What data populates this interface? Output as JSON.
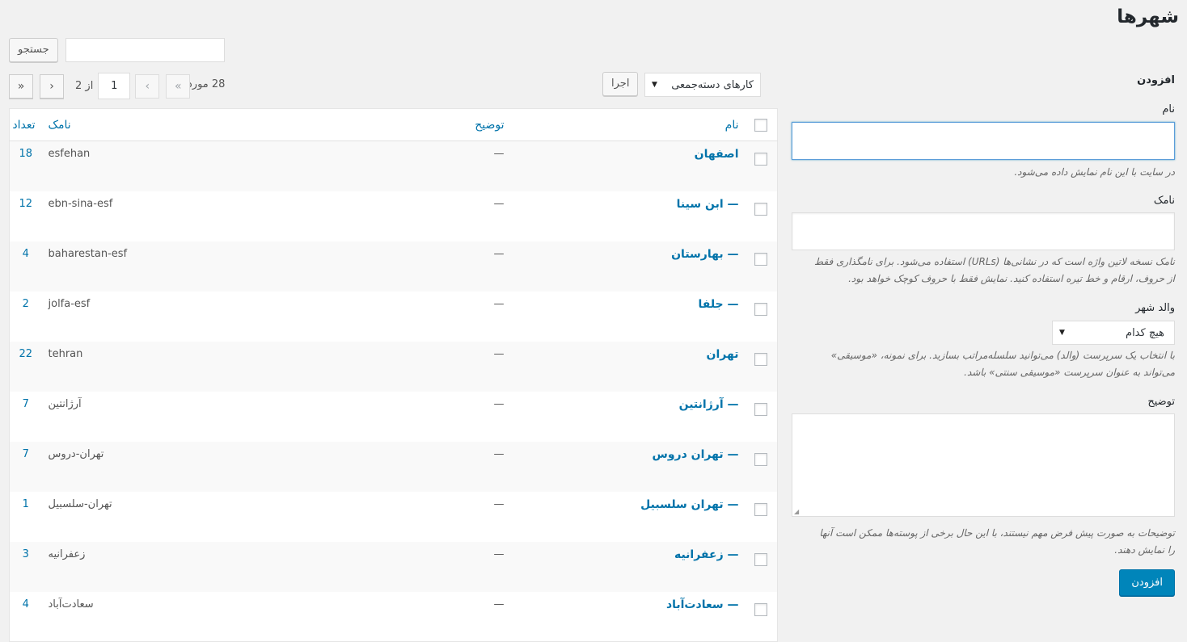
{
  "page": {
    "title": "شهرها"
  },
  "search": {
    "button_label": "جستجو",
    "value": ""
  },
  "bulk": {
    "selected": "کارهای دسته‌جمعی",
    "apply_label": "اجرا"
  },
  "pagination": {
    "items_text": "28 مورد",
    "current_page": "1",
    "of_text": "از 2",
    "first": "«",
    "prev": "‹",
    "next": "›",
    "last": "»"
  },
  "table": {
    "headers": {
      "name": "نام",
      "description": "توضیح",
      "slug": "نامک",
      "count": "تعداد"
    },
    "rows": [
      {
        "name": "اصفهان",
        "description": "—",
        "slug": "esfehan",
        "count": "18"
      },
      {
        "name": "— ابن سینا",
        "description": "—",
        "slug": "ebn-sina-esf",
        "count": "12"
      },
      {
        "name": "— بهارستان",
        "description": "—",
        "slug": "baharestan-esf",
        "count": "4"
      },
      {
        "name": "— جلفا",
        "description": "—",
        "slug": "jolfa-esf",
        "count": "2"
      },
      {
        "name": "تهران",
        "description": "—",
        "slug": "tehran",
        "count": "22"
      },
      {
        "name": "— آرژانتین",
        "description": "—",
        "slug": "آرژانتین",
        "count": "7"
      },
      {
        "name": "— تهران دروس",
        "description": "—",
        "slug": "تهران-دروس",
        "count": "7"
      },
      {
        "name": "— تهران سلسبیل",
        "description": "—",
        "slug": "تهران-سلسبیل",
        "count": "1"
      },
      {
        "name": "— زعفرانیه",
        "description": "—",
        "slug": "زعفرانیه",
        "count": "3"
      },
      {
        "name": "— سعادت‌آباد",
        "description": "—",
        "slug": "سعادت‌آباد",
        "count": "4"
      }
    ]
  },
  "form": {
    "heading": "افزودن",
    "name_label": "نام",
    "name_value": "",
    "name_hint": "در سایت با این نام نمایش داده می‌شود.",
    "slug_label": "نامک",
    "slug_value": "",
    "slug_hint_1": "نامک نسخه لاتین واژه است که در نشانی‌ها (URLs) استفاده می‌شود. برای نامگذاری فقط",
    "slug_hint_2": "از حروف، ارقام و خط تیره استفاده کنید. نمایش فقط با حروف کوچک خواهد بود.",
    "parent_label": "والد شهر",
    "parent_selected": "هیچ کدام",
    "parent_hint_1": "با انتخاب یک سرپرست (والد) می‌توانید سلسله‌مراتب بسازید. برای نمونه، «موسیقی»",
    "parent_hint_2": "می‌تواند به عنوان سرپرست «موسیقی سنتی» باشد.",
    "desc_label": "توضیح",
    "desc_value": "",
    "desc_hint_1": "توضیحات به صورت پیش فرض مهم نیستند، با این حال برخی از پوسته‌ها ممکن است آنها",
    "desc_hint_2": "را نمایش دهند.",
    "submit_label": "افزودن"
  },
  "icons": {
    "dropdown": "triangle-down-icon"
  }
}
